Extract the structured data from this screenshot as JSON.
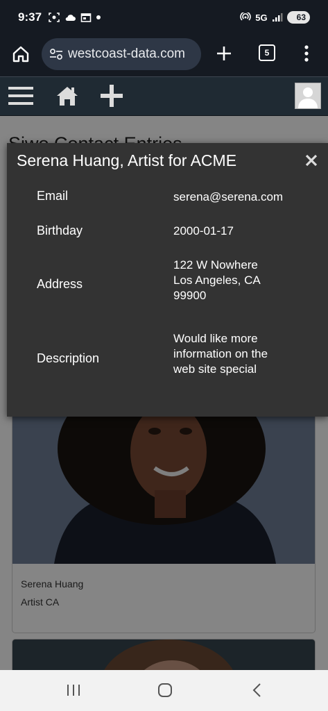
{
  "status_bar": {
    "time": "9:37",
    "network": "5G",
    "battery": "63",
    "icons": [
      "screenshot-icon",
      "cloud-icon",
      "calendar-icon",
      "dot-icon",
      "hotspot-icon",
      "signal-icon",
      "battery-icon"
    ]
  },
  "browser": {
    "url": "westcoast-data.com",
    "tab_count": "5",
    "icons": [
      "home-icon",
      "site-info-icon",
      "plus-icon",
      "tab-switcher-icon",
      "more-vert-icon"
    ]
  },
  "app_nav": {
    "icons": [
      "hamburger-menu-icon",
      "home-icon",
      "add-icon",
      "user-avatar-icon"
    ]
  },
  "page": {
    "title": "Siwo Contact Entries",
    "cards": [
      {
        "name": "Serena Huang",
        "subtitle": "Artist CA"
      }
    ]
  },
  "modal": {
    "title": "Serena Huang, Artist for ACME",
    "fields": [
      {
        "label": "Email",
        "value": "serena@serena.com"
      },
      {
        "label": "Birthday",
        "value": "2000-01-17"
      },
      {
        "label": "Address",
        "lines": [
          "122 W Nowhere",
          "Los Angeles, CA",
          "99900"
        ]
      },
      {
        "label": "Description",
        "lines": [
          "Would like more",
          "information on the",
          "web site special"
        ]
      }
    ]
  },
  "colors": {
    "chrome_bg": "#151a22",
    "app_nav_bg": "#1f2a33",
    "modal_bg": "#333333",
    "url_pill_bg": "#2e3746"
  }
}
